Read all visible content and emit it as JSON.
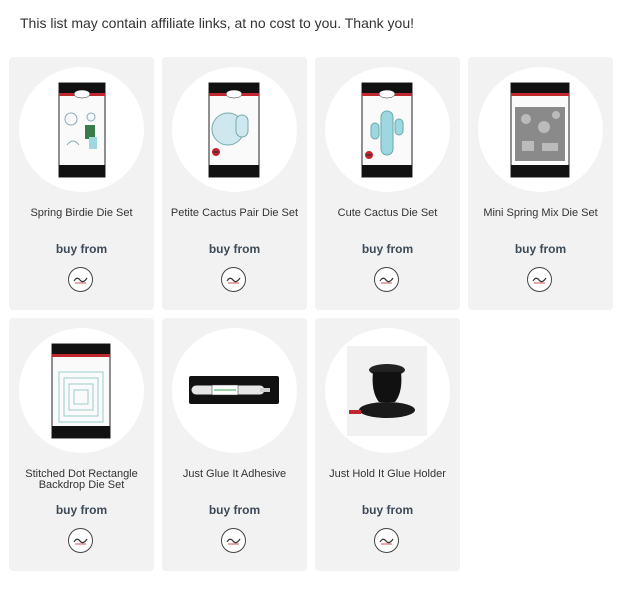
{
  "disclaimer": "This list may contain affiliate links, at no cost to you. Thank you!",
  "buy_label": "buy from",
  "retailer_icon": "the-stamps-of-life-logo-icon",
  "products": [
    {
      "title": "Spring Birdie Die Set",
      "image": "die-set-package-birdie"
    },
    {
      "title": "Petite Cactus Pair Die Set",
      "image": "die-set-package-cactus-pair"
    },
    {
      "title": "Cute Cactus Die Set",
      "image": "die-set-package-cactus"
    },
    {
      "title": "Mini Spring Mix Die Set",
      "image": "die-set-package-spring-mix"
    },
    {
      "title": "Stitched Dot Rectangle Backdrop Die Set",
      "image": "die-set-package-rectangles"
    },
    {
      "title": "Just Glue It Adhesive",
      "image": "glue-pen"
    },
    {
      "title": "Just Hold It Glue Holder",
      "image": "glue-holder"
    }
  ]
}
